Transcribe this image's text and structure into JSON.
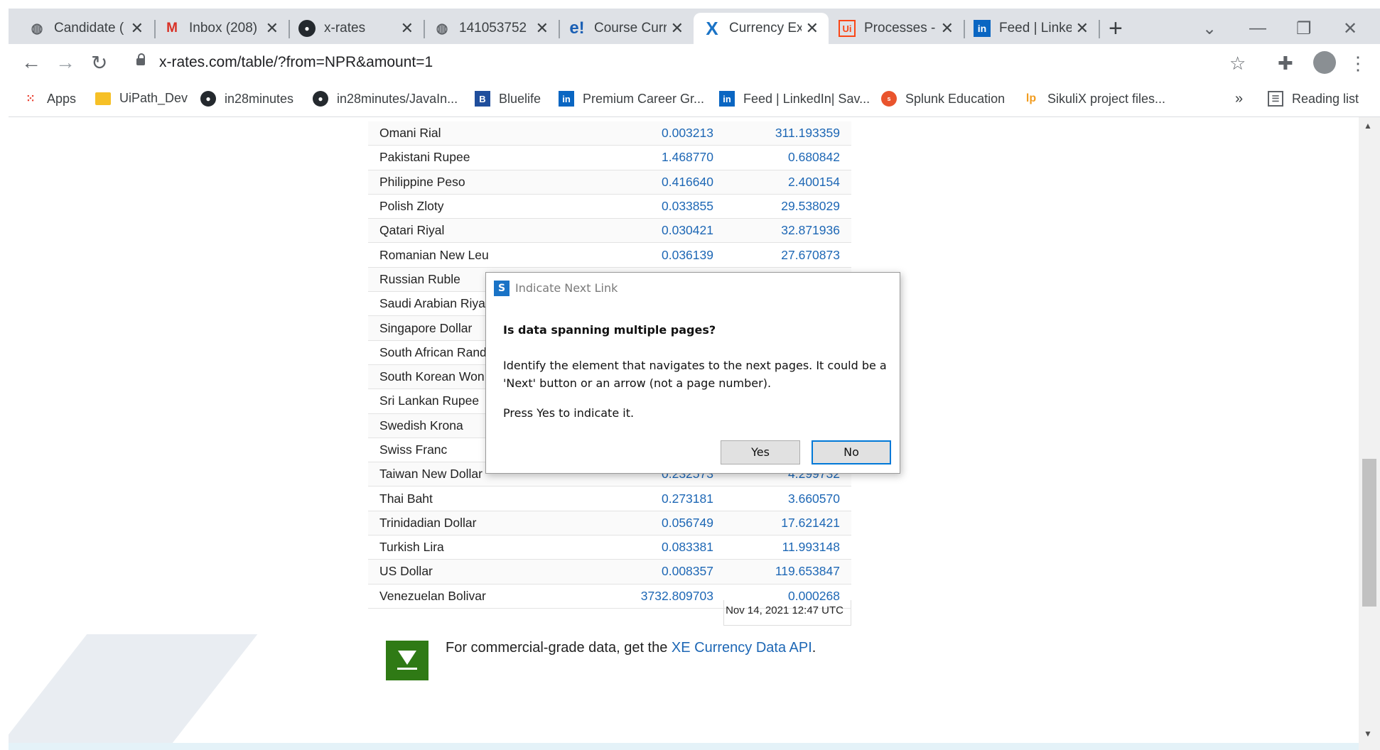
{
  "browser": {
    "tabs": [
      {
        "label": "Candidate (",
        "icon": "globe-icon"
      },
      {
        "label": "Inbox (208)",
        "icon": "gmail-icon"
      },
      {
        "label": "x-rates",
        "icon": "github-icon"
      },
      {
        "label": "141053752",
        "icon": "globe-icon"
      },
      {
        "label": "Course Curr",
        "icon": "edureka-icon"
      },
      {
        "label": "Currency Ex",
        "icon": "xrates-icon",
        "active": true
      },
      {
        "label": "Processes -",
        "icon": "uipath-icon"
      },
      {
        "label": "Feed | Linke",
        "icon": "linkedin-icon"
      }
    ],
    "new_tab": "+",
    "url": "x-rates.com/table/?from=NPR&amount=1",
    "bookmarks": [
      {
        "label": "Apps",
        "icon": "apps-grid-icon"
      },
      {
        "label": "UiPath_Dev",
        "icon": "folder-icon"
      },
      {
        "label": "in28minutes",
        "icon": "github-icon"
      },
      {
        "label": "in28minutes/JavaIn...",
        "icon": "github-icon"
      },
      {
        "label": "Bluelife",
        "icon": "bluelife-icon"
      },
      {
        "label": "Premium Career Gr...",
        "icon": "linkedin-icon"
      },
      {
        "label": "Feed | LinkedIn| Sav...",
        "icon": "linkedin-icon"
      },
      {
        "label": "Splunk Education",
        "icon": "splunk-icon"
      },
      {
        "label": "SikuliX project files...",
        "icon": "launchpad-icon"
      }
    ],
    "more_bookmarks": "»",
    "reading_list": "Reading list"
  },
  "rates_table": {
    "rows": [
      {
        "name": "Omani Rial",
        "value": "0.003213",
        "inverse": "311.193359"
      },
      {
        "name": "Pakistani Rupee",
        "value": "1.468770",
        "inverse": "0.680842"
      },
      {
        "name": "Philippine Peso",
        "value": "0.416640",
        "inverse": "2.400154"
      },
      {
        "name": "Polish Zloty",
        "value": "0.033855",
        "inverse": "29.538029"
      },
      {
        "name": "Qatari Riyal",
        "value": "0.030421",
        "inverse": "32.871936"
      },
      {
        "name": "Romanian New Leu",
        "value": "0.036139",
        "inverse": "27.670873"
      },
      {
        "name": "Russian Ruble",
        "value": "",
        "inverse": ""
      },
      {
        "name": "Saudi Arabian Riyal",
        "value": "",
        "inverse": ""
      },
      {
        "name": "Singapore Dollar",
        "value": "",
        "inverse": ""
      },
      {
        "name": "South African Rand",
        "value": "",
        "inverse": ""
      },
      {
        "name": "South Korean Won",
        "value": "",
        "inverse": ""
      },
      {
        "name": "Sri Lankan Rupee",
        "value": "",
        "inverse": ""
      },
      {
        "name": "Swedish Krona",
        "value": "",
        "inverse": ""
      },
      {
        "name": "Swiss Franc",
        "value": "",
        "inverse": ""
      },
      {
        "name": "Taiwan New Dollar",
        "value": "0.232573",
        "inverse": "4.299732"
      },
      {
        "name": "Thai Baht",
        "value": "0.273181",
        "inverse": "3.660570"
      },
      {
        "name": "Trinidadian Dollar",
        "value": "0.056749",
        "inverse": "17.621421"
      },
      {
        "name": "Turkish Lira",
        "value": "0.083381",
        "inverse": "11.993148"
      },
      {
        "name": "US Dollar",
        "value": "0.008357",
        "inverse": "119.653847"
      },
      {
        "name": "Venezuelan Bolivar",
        "value": "3732.809703",
        "inverse": "0.000268"
      }
    ],
    "timestamp": "Nov 14, 2021 12:47 UTC"
  },
  "api_promo": {
    "text": "For commercial-grade data, get the ",
    "link": "XE Currency Data API",
    "suffix": "."
  },
  "dialog": {
    "title": "Indicate Next Link",
    "question": "Is data spanning multiple pages?",
    "body": "Identify the element that navigates to the next pages. It could be a 'Next' button or an arrow (not a page number).",
    "press": "Press Yes to indicate it.",
    "yes": "Yes",
    "no": "No"
  },
  "colors": {
    "link_blue": "#1d67b5",
    "download_green": "#2f7a15",
    "dialog_focus": "#0078d7"
  }
}
